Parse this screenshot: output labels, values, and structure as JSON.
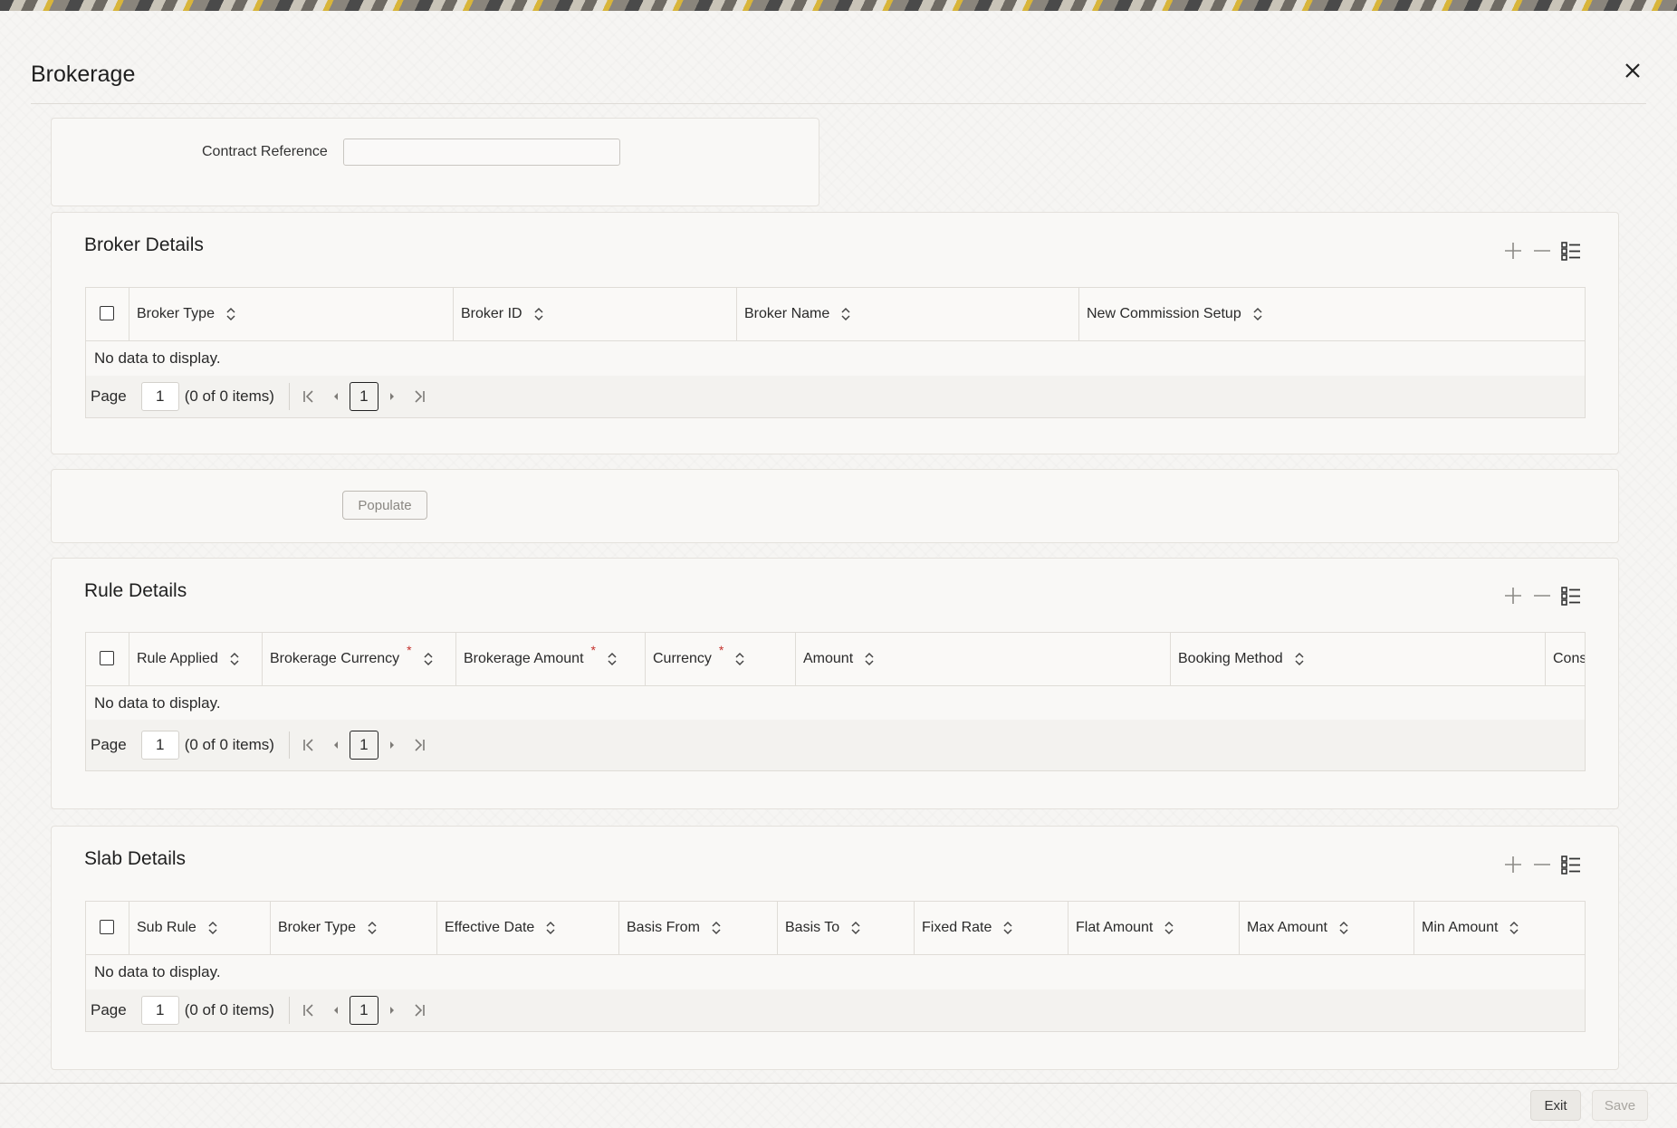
{
  "window": {
    "title": "Brokerage"
  },
  "contract": {
    "label": "Contract Reference",
    "value": ""
  },
  "populate": {
    "label": "Populate"
  },
  "colors": {
    "accent_required": "#c4302b",
    "panel": "#f9f8f6",
    "border": "#dfdcd7"
  },
  "icons": {
    "close": "close-icon",
    "add": "plus-icon",
    "delete": "minus-icon",
    "view": "list-view-icon",
    "sort": "sort-icon"
  },
  "broker_details": {
    "title": "Broker Details",
    "columns": [
      "Broker Type",
      "Broker ID",
      "Broker Name",
      "New Commission Setup"
    ],
    "empty_text": "No data to display.",
    "pager": {
      "label": "Page",
      "page": "1",
      "items": "(0 of 0 items)",
      "current": "1"
    }
  },
  "rule_details": {
    "title": "Rule Details",
    "columns": [
      "Rule Applied",
      "Brokerage Currency",
      "Brokerage Amount",
      "Currency",
      "Amount",
      "Booking Method",
      "Cons"
    ],
    "required_mark": "*",
    "empty_text": "No data to display.",
    "pager": {
      "label": "Page",
      "page": "1",
      "items": "(0 of 0 items)",
      "current": "1"
    }
  },
  "slab_details": {
    "title": "Slab Details",
    "columns": [
      "Sub Rule",
      "Broker Type",
      "Effective Date",
      "Basis From",
      "Basis To",
      "Fixed Rate",
      "Flat Amount",
      "Max Amount",
      "Min Amount"
    ],
    "empty_text": "No data to display.",
    "pager": {
      "label": "Page",
      "page": "1",
      "items": "(0 of 0 items)",
      "current": "1"
    }
  },
  "footer": {
    "exit": "Exit",
    "save": "Save"
  }
}
